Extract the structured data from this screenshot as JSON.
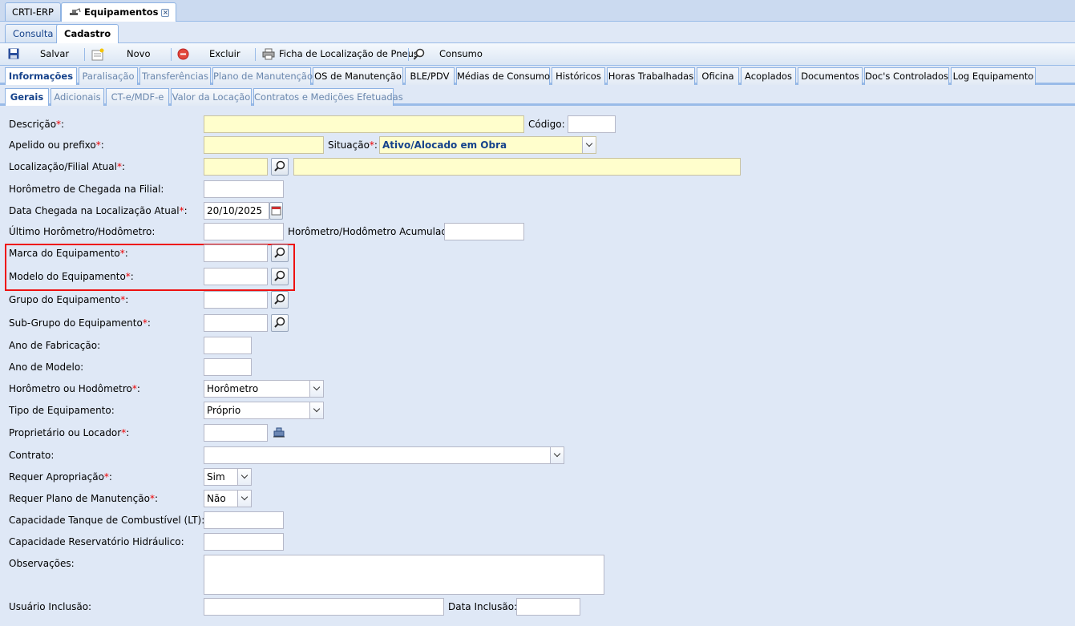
{
  "window_tabs": [
    "CRTI-ERP",
    "Equipamentos"
  ],
  "mode_tabs": [
    "Consulta",
    "Cadastro"
  ],
  "toolbar": {
    "save": "Salvar",
    "new": "Novo",
    "delete": "Excluir",
    "tire_sheet": "Ficha de Localização de Pneus",
    "consumption": "Consumo"
  },
  "main_tabs": [
    "Informações",
    "Paralisação",
    "Transferências",
    "Plano de Manutenção",
    "OS de Manutenção",
    "BLE/PDV",
    "Médias de Consumo",
    "Históricos",
    "Horas Trabalhadas",
    "Oficina",
    "Acoplados",
    "Documentos",
    "Doc's Controlados",
    "Log Equipamento"
  ],
  "sub_tabs": [
    "Gerais",
    "Adicionais",
    "CT-e/MDF-e",
    "Valor da Locação",
    "Contratos e Medições Efetuadas"
  ],
  "form": {
    "descricao": "Descrição",
    "codigo": "Código:",
    "apelido": "Apelido ou prefixo",
    "situacao": "Situação",
    "situacao_value": "Ativo/Alocado em Obra",
    "localizacao": "Localização/Filial Atual",
    "horometro_chegada": "Horômetro de Chegada na Filial:",
    "data_chegada": "Data Chegada na Localização Atual",
    "data_chegada_value": "20/10/2025",
    "ultimo_horometro": "Último Horômetro/Hodômetro:",
    "horometro_acumulado": "Horômetro/Hodômetro Acumulado:",
    "marca": "Marca do Equipamento",
    "modelo": "Modelo do Equipamento",
    "grupo": "Grupo do Equipamento",
    "subgrupo": "Sub-Grupo do Equipamento",
    "ano_fabricacao": "Ano de Fabricação:",
    "ano_modelo": "Ano de Modelo:",
    "horometro_ou_hodometro": "Horômetro ou Hodômetro",
    "horometro_ou_hodometro_value": "Horômetro",
    "tipo": "Tipo de Equipamento:",
    "tipo_value": "Próprio",
    "proprietario": "Proprietário ou Locador",
    "contrato": "Contrato:",
    "req_apropriacao": "Requer Apropriação",
    "req_apropriacao_value": "Sim",
    "req_plano": "Requer Plano de Manutenção",
    "req_plano_value": "Não",
    "cap_combustivel": "Capacidade Tanque de Combustível (LT):",
    "cap_hidraulico": "Capacidade Reservatório Hidráulico:",
    "observacoes": "Observações:",
    "usuario_inclusao": "Usuário Inclusão:",
    "data_inclusao": "Data Inclusão:"
  },
  "required_marker": "*",
  "colon": ":"
}
